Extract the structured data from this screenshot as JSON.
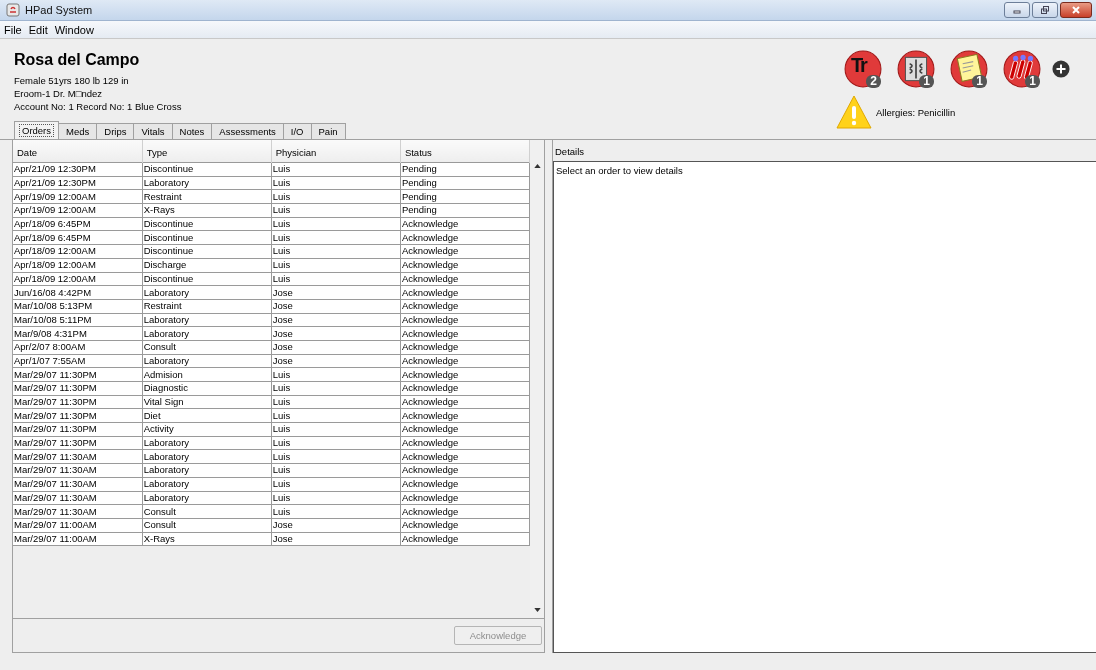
{
  "window": {
    "title": "HPad System"
  },
  "menu": [
    "File",
    "Edit",
    "Window"
  ],
  "patient": {
    "name": "Rosa del Campo",
    "lines": [
      "Female 51yrs 180 lb 129 in",
      "Eroom-1 Dr. M□ndez",
      "Account No: 1 Record No: 1  Blue Cross"
    ]
  },
  "badges": [
    {
      "kind": "tr",
      "text": "Tr",
      "count": "2"
    },
    {
      "kind": "xray",
      "count": "1"
    },
    {
      "kind": "note",
      "count": "1"
    },
    {
      "kind": "tubes",
      "count": "1"
    }
  ],
  "allergies": "Allergies: Penicillin",
  "tabs": [
    {
      "label": "Orders",
      "selected": true
    },
    {
      "label": "Meds",
      "selected": false
    },
    {
      "label": "Drips",
      "selected": false
    },
    {
      "label": "Vitals",
      "selected": false
    },
    {
      "label": "Notes",
      "selected": false
    },
    {
      "label": "Assessments",
      "selected": false
    },
    {
      "label": "I/O",
      "selected": false
    },
    {
      "label": "Pain",
      "selected": false
    }
  ],
  "table": {
    "columns": [
      "Date",
      "Type",
      "Physician",
      "Status"
    ],
    "rows": [
      [
        "Apr/21/09 12:30PM",
        "Discontinue",
        "Luis",
        "Pending"
      ],
      [
        "Apr/21/09 12:30PM",
        "Laboratory",
        "Luis",
        "Pending"
      ],
      [
        "Apr/19/09 12:00AM",
        "Restraint",
        "Luis",
        "Pending"
      ],
      [
        "Apr/19/09 12:00AM",
        "X-Rays",
        "Luis",
        "Pending"
      ],
      [
        "Apr/18/09 6:45PM",
        "Discontinue",
        "Luis",
        "Acknowledge"
      ],
      [
        "Apr/18/09 6:45PM",
        "Discontinue",
        "Luis",
        "Acknowledge"
      ],
      [
        "Apr/18/09 12:00AM",
        "Discontinue",
        "Luis",
        "Acknowledge"
      ],
      [
        "Apr/18/09 12:00AM",
        "Discharge",
        "Luis",
        "Acknowledge"
      ],
      [
        "Apr/18/09 12:00AM",
        "Discontinue",
        "Luis",
        "Acknowledge"
      ],
      [
        "Jun/16/08 4:42PM",
        "Laboratory",
        "Jose",
        "Acknowledge"
      ],
      [
        "Mar/10/08 5:13PM",
        "Restraint",
        "Jose",
        "Acknowledge"
      ],
      [
        "Mar/10/08 5:11PM",
        "Laboratory",
        "Jose",
        "Acknowledge"
      ],
      [
        "Mar/9/08 4:31PM",
        "Laboratory",
        "Jose",
        "Acknowledge"
      ],
      [
        "Apr/2/07 8:00AM",
        "Consult",
        "Jose",
        "Acknowledge"
      ],
      [
        "Apr/1/07 7:55AM",
        "Laboratory",
        "Jose",
        "Acknowledge"
      ],
      [
        "Mar/29/07 11:30PM",
        "Admision",
        "Luis",
        "Acknowledge"
      ],
      [
        "Mar/29/07 11:30PM",
        "Diagnostic",
        "Luis",
        "Acknowledge"
      ],
      [
        "Mar/29/07 11:30PM",
        "Vital Sign",
        "Luis",
        "Acknowledge"
      ],
      [
        "Mar/29/07 11:30PM",
        "Diet",
        "Luis",
        "Acknowledge"
      ],
      [
        "Mar/29/07 11:30PM",
        "Activity",
        "Luis",
        "Acknowledge"
      ],
      [
        "Mar/29/07 11:30PM",
        "Laboratory",
        "Luis",
        "Acknowledge"
      ],
      [
        "Mar/29/07 11:30AM",
        "Laboratory",
        "Luis",
        "Acknowledge"
      ],
      [
        "Mar/29/07 11:30AM",
        "Laboratory",
        "Luis",
        "Acknowledge"
      ],
      [
        "Mar/29/07 11:30AM",
        "Laboratory",
        "Luis",
        "Acknowledge"
      ],
      [
        "Mar/29/07 11:30AM",
        "Laboratory",
        "Luis",
        "Acknowledge"
      ],
      [
        "Mar/29/07 11:30AM",
        "Consult",
        "Luis",
        "Acknowledge"
      ],
      [
        "Mar/29/07 11:00AM",
        "Consult",
        "Jose",
        "Acknowledge"
      ],
      [
        "Mar/29/07 11:00AM",
        "X-Rays",
        "Jose",
        "Acknowledge"
      ]
    ]
  },
  "acknowledge_button": {
    "label": "Acknowledge",
    "disabled": true
  },
  "details": {
    "title": "Details",
    "text": "Select an order to view details"
  }
}
